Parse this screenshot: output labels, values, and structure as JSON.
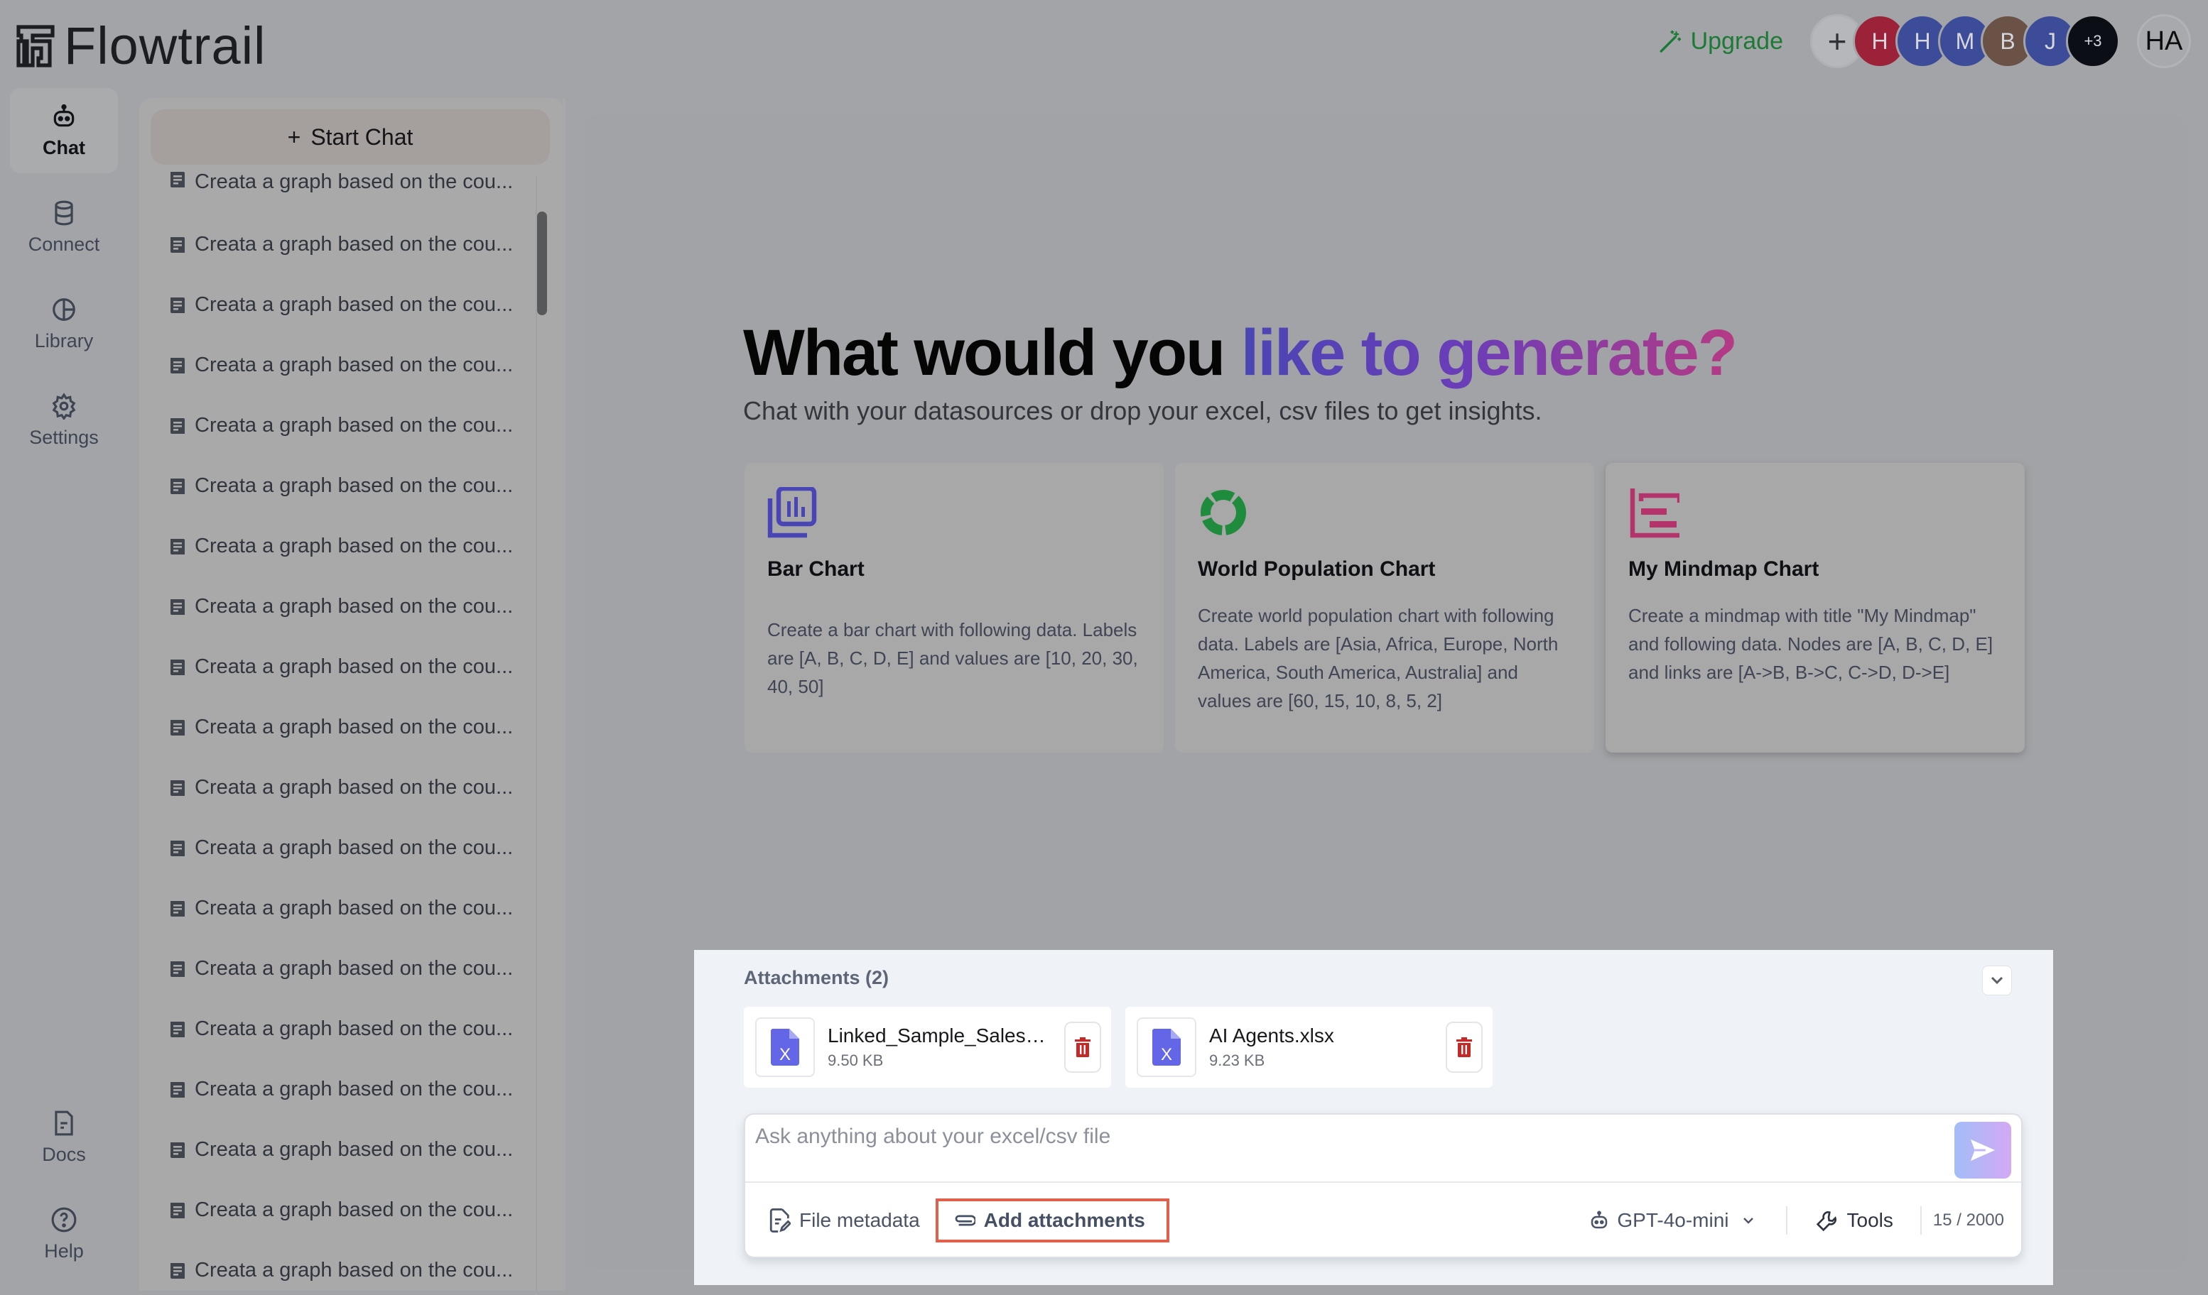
{
  "app": {
    "name": "Flowtrail"
  },
  "topbar": {
    "upgrade_label": "Upgrade",
    "add_member_label": "+",
    "members": [
      {
        "initial": "H",
        "color": "#9b2239"
      },
      {
        "initial": "H",
        "color": "#3d4c98"
      },
      {
        "initial": "M",
        "color": "#3d4c98"
      },
      {
        "initial": "B",
        "color": "#6a5247"
      },
      {
        "initial": "J",
        "color": "#3d4c98"
      }
    ],
    "more_members_label": "+3",
    "more_members_color": "#0c0e16",
    "current_user_initials": "HA"
  },
  "nav": {
    "top_items": [
      {
        "label": "Chat",
        "icon": "robot-icon",
        "active": true
      },
      {
        "label": "Connect",
        "icon": "database-icon",
        "active": false
      },
      {
        "label": "Library",
        "icon": "pie-chart-icon",
        "active": false
      },
      {
        "label": "Settings",
        "icon": "gear-icon",
        "active": false
      }
    ],
    "bottom_items": [
      {
        "label": "Docs",
        "icon": "document-icon"
      },
      {
        "label": "Help",
        "icon": "help-circle-icon"
      }
    ]
  },
  "history": {
    "start_chat_label": "Start Chat",
    "start_chat_icon": "+",
    "items": [
      "Creata a graph based on the cou...",
      "Creata a graph based on the cou...",
      "Creata a graph based on the cou...",
      "Creata a graph based on the cou...",
      "Creata a graph based on the cou...",
      "Creata a graph based on the cou...",
      "Creata a graph based on the cou...",
      "Creata a graph based on the cou...",
      "Creata a graph based on the cou...",
      "Creata a graph based on the cou...",
      "Creata a graph based on the cou...",
      "Creata a graph based on the cou...",
      "Creata a graph based on the cou...",
      "Creata a graph based on the cou...",
      "Creata a graph based on the cou...",
      "Creata a graph based on the cou...",
      "Creata a graph based on the cou...",
      "Creata a graph based on the cou...",
      "Creata a graph based on the cou..."
    ]
  },
  "hero": {
    "title_plain": "What would you ",
    "title_highlight": "like to generate?",
    "subtitle": "Chat with your datasources or drop your excel, csv files to get insights."
  },
  "templates": [
    {
      "title": "Bar Chart",
      "icon": "bar-chart-icon",
      "icon_color": "#4a45b4",
      "description": "Create a bar chart with following data. Labels are [A, B, C, D, E] and values are [10, 20, 30, 40, 50]"
    },
    {
      "title": "World Population Chart",
      "icon": "donut-chart-icon",
      "icon_color": "#1e8b3d",
      "description": "Create world population chart with following data. Labels are [Asia, Africa, Europe, North America, South America, Australia] and values are [60, 15, 10, 8, 5, 2]"
    },
    {
      "title": "My Mindmap Chart",
      "icon": "mindmap-icon",
      "icon_color": "#b5336b",
      "description": "Create a mindmap with title \"My Mindmap\" and following data. Nodes are [A, B, C, D, E] and links are [A->B, B->C, C->D, D->E]"
    }
  ],
  "composer": {
    "attachments_title": "Attachments (2)",
    "attachments": [
      {
        "name": "Linked_Sample_Sales_...",
        "size": "9.50 KB",
        "type": "xlsx"
      },
      {
        "name": "AI Agents.xlsx",
        "size": "9.23 KB",
        "type": "xlsx"
      }
    ],
    "input_value": "",
    "input_placeholder": "Ask anything about your excel/csv file",
    "file_metadata_label": "File metadata",
    "add_attachments_label": "Add attachments",
    "model_label": "GPT-4o-mini",
    "tools_label": "Tools",
    "char_count": "15 / 2000"
  },
  "colors": {
    "upgrade": "#1c7a35",
    "highlight_annotation": "#e0604c",
    "delete": "#c62828",
    "file_icon": "#6366e6"
  }
}
